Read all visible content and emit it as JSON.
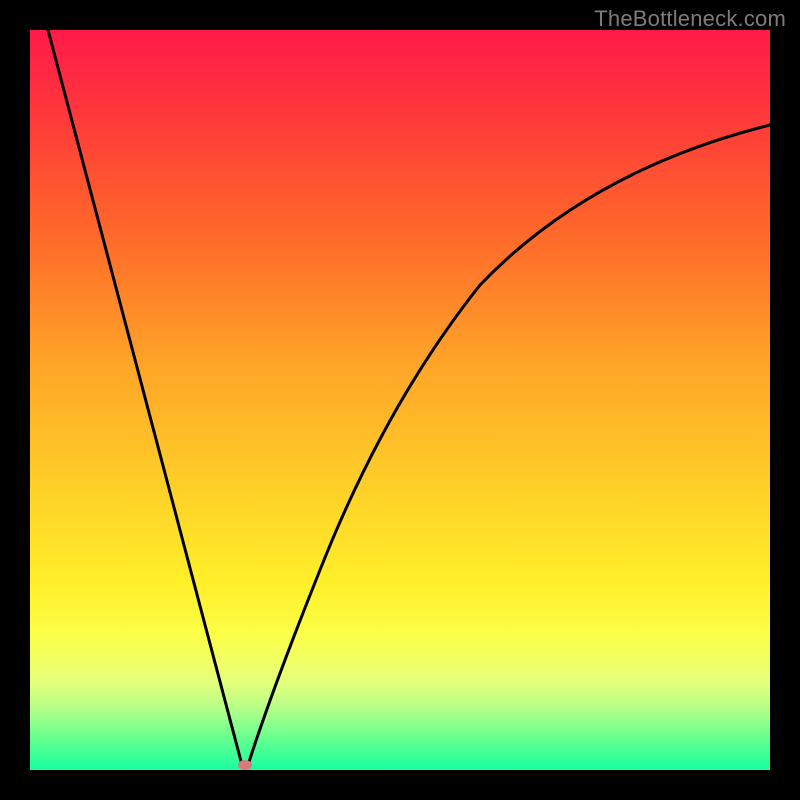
{
  "watermark": "TheBottleneck.com",
  "colors": {
    "frame": "#000000",
    "curve": "#000000",
    "marker": "#d77a7a",
    "gradient_top": "#ff1a4a",
    "gradient_bottom": "#18ffa0"
  },
  "chart_data": {
    "type": "line",
    "title": "",
    "xlabel": "",
    "ylabel": "",
    "xlim": [
      0,
      100
    ],
    "ylim": [
      0,
      100
    ],
    "comment": "Bottleneck-style V curve. Minimum near x≈29, y≈0. Left branch nearly linear from top-left corner down to the minimum; right branch rises with decreasing slope toward upper right.",
    "minimum": {
      "x": 29,
      "y": 0
    },
    "series": [
      {
        "name": "bottleneck-curve",
        "x": [
          0,
          5,
          10,
          15,
          20,
          25,
          28,
          29,
          30,
          33,
          37,
          42,
          48,
          55,
          63,
          72,
          82,
          91,
          100
        ],
        "values": [
          100,
          83,
          66,
          49,
          32,
          15,
          3,
          0,
          2,
          10,
          22,
          35,
          48,
          58,
          67,
          74,
          80,
          84,
          87
        ]
      }
    ]
  }
}
